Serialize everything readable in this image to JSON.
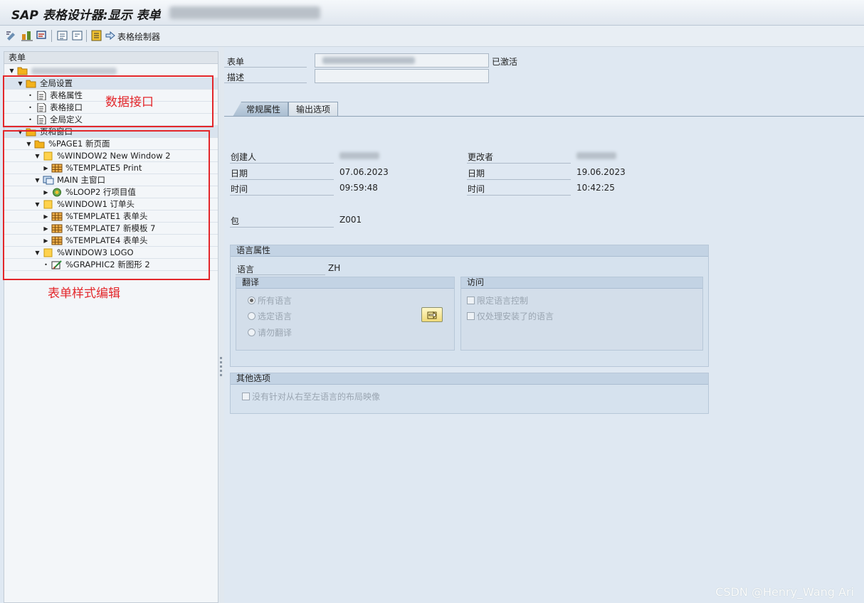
{
  "window": {
    "title": "SAP 表格设计器:显示 表单"
  },
  "toolbar": {
    "painter_label": "表格绘制器"
  },
  "tree": {
    "header": "表单",
    "nodes": {
      "global_settings": "全局设置",
      "form_attributes": "表格属性",
      "form_interface": "表格接口",
      "global_definitions": "全局定义",
      "pages_windows": "页和窗口",
      "page1": "%PAGE1 新页面",
      "window2": "%WINDOW2 New Window 2",
      "template5": "%TEMPLATE5 Print",
      "main": "MAIN 主窗口",
      "loop2": "%LOOP2 行项目值",
      "window1": "%WINDOW1 订单头",
      "template1": "%TEMPLATE1 表单头",
      "template7": "%TEMPLATE7 新模板 7",
      "template4": "%TEMPLATE4 表单头",
      "window3": "%WINDOW3 LOGO",
      "graphic2": "%GRAPHIC2 新图形 2"
    }
  },
  "annotations": {
    "data_interface": "数据接口",
    "form_style_edit": "表单样式编辑"
  },
  "header_fields": {
    "form_label": "表单",
    "status": "已激活",
    "desc_label": "描述"
  },
  "tabs": {
    "general": "常规属性",
    "output": "输出选项"
  },
  "admin": {
    "created_by_label": "创建人",
    "created_date_label": "日期",
    "created_date": "07.06.2023",
    "created_time_label": "时间",
    "created_time": "09:59:48",
    "changed_by_label": "更改者",
    "changed_date_label": "日期",
    "changed_date": "19.06.2023",
    "changed_time_label": "时间",
    "changed_time": "10:42:25",
    "package_label": "包",
    "package": "Z001"
  },
  "language": {
    "group_title": "语言属性",
    "lang_label": "语言",
    "lang_value": "ZH",
    "translate_title": "翻译",
    "opt_all": "所有语言",
    "opt_selected": "选定语言",
    "opt_none": "请勿翻译",
    "access_title": "访问",
    "chk_restrict": "限定语言控制",
    "chk_installed": "仅处理安装了的语言"
  },
  "other": {
    "group_title": "其他选项",
    "chk_rtl": "没有针对从右至左语言的布局映像"
  },
  "watermark": "CSDN @Henry_Wang Ari",
  "colors": {
    "annotation": "#e3262a",
    "folder": "#f3b21b"
  }
}
